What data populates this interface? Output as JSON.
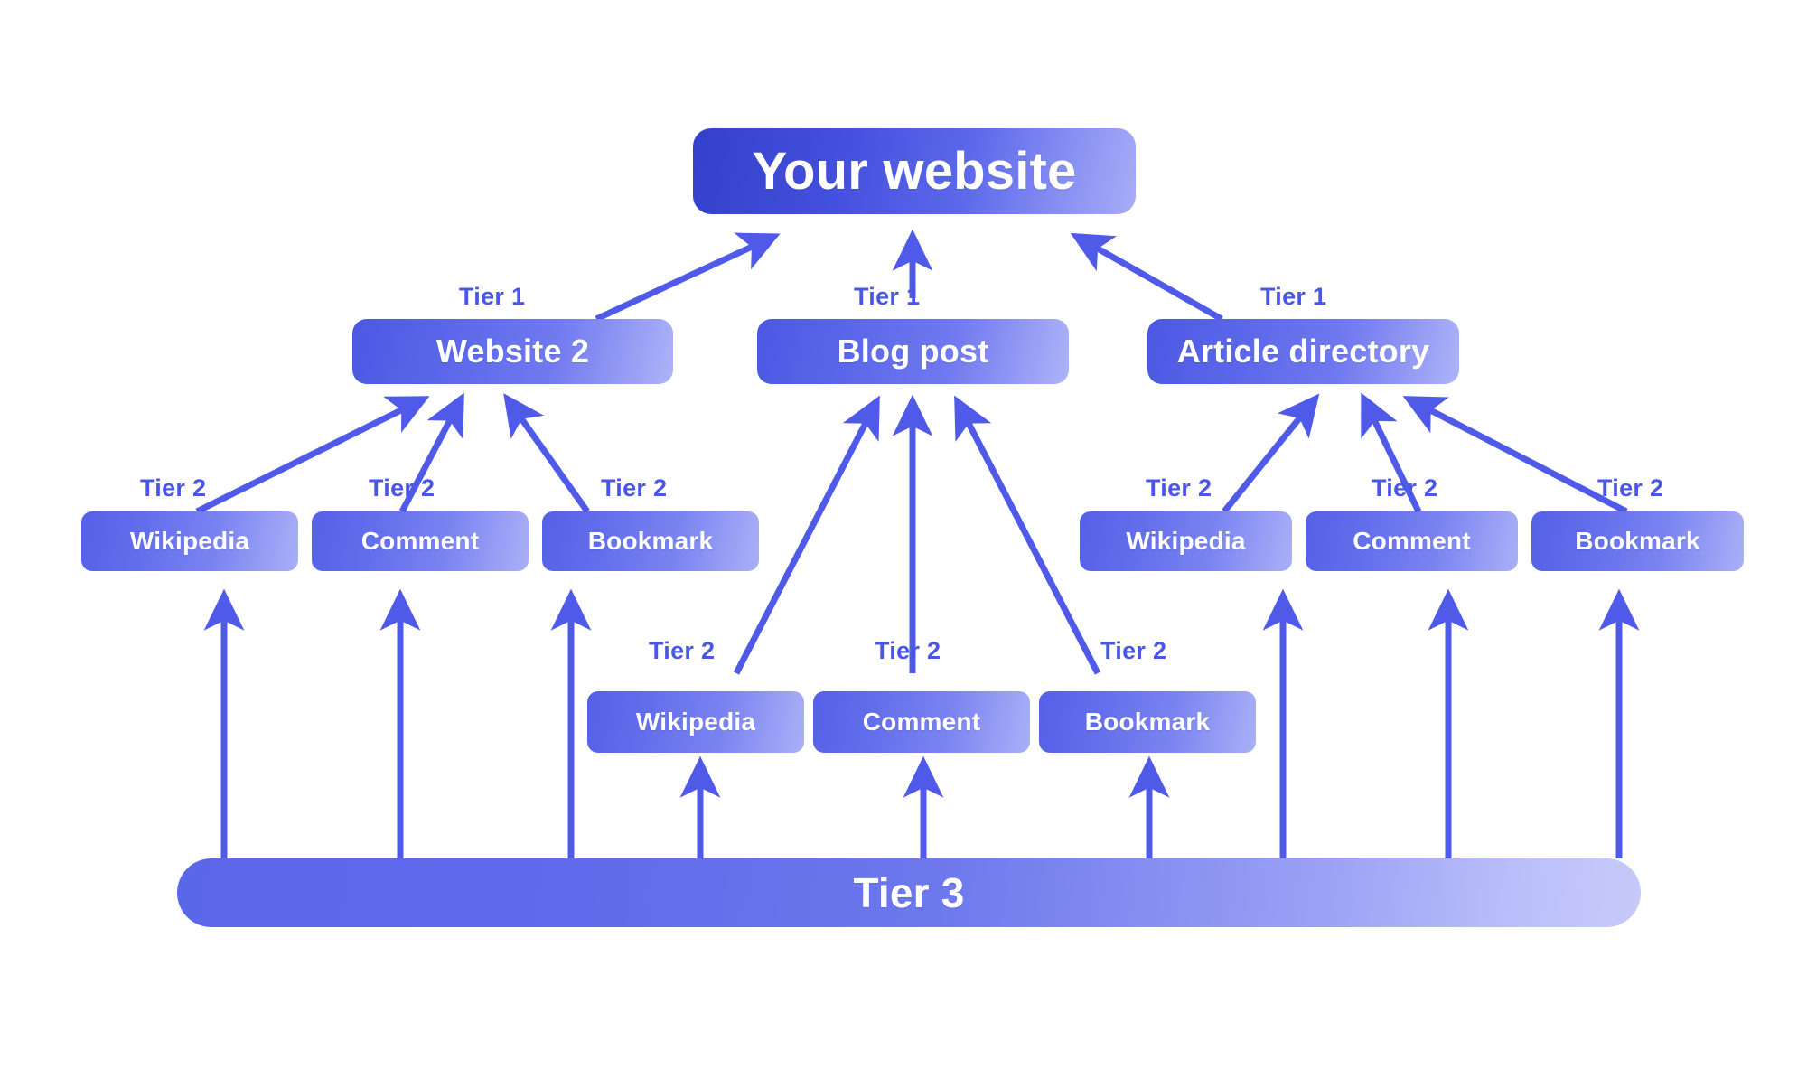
{
  "diagram": {
    "title_node": {
      "label": "Your website"
    },
    "palette": {
      "background": "#ffffff",
      "edge": "#4f5be8",
      "label_text": "#4a57e6",
      "node_text": "#ffffff",
      "gradient_dark": "#3341c9",
      "gradient_mid": "#5b67e9",
      "gradient_light": "#b5b8f5"
    },
    "tier1_label": "Tier 1",
    "tier2_label": "Tier 2",
    "tier1_nodes": [
      {
        "label": "Website 2"
      },
      {
        "label": "Blog post"
      },
      {
        "label": "Article directory"
      }
    ],
    "tier2_groups": [
      {
        "parent": "Website 2",
        "nodes": [
          {
            "label": "Wikipedia"
          },
          {
            "label": "Comment"
          },
          {
            "label": "Bookmark"
          }
        ]
      },
      {
        "parent": "Blog post",
        "nodes": [
          {
            "label": "Wikipedia"
          },
          {
            "label": "Comment"
          },
          {
            "label": "Bookmark"
          }
        ]
      },
      {
        "parent": "Article directory",
        "nodes": [
          {
            "label": "Wikipedia"
          },
          {
            "label": "Comment"
          },
          {
            "label": "Bookmark"
          }
        ]
      }
    ],
    "tier3_bar": {
      "label": "Tier 3"
    },
    "tier1_labels": [
      "Tier 1",
      "Tier 1",
      "Tier 1"
    ],
    "tier2_labels_left": [
      "Tier 2",
      "Tier 2",
      "Tier 2"
    ],
    "tier2_labels_middle": [
      "Tier 2",
      "Tier 2",
      "Tier 2"
    ],
    "tier2_labels_right": [
      "Tier 2",
      "Tier 2",
      "Tier 2"
    ]
  }
}
